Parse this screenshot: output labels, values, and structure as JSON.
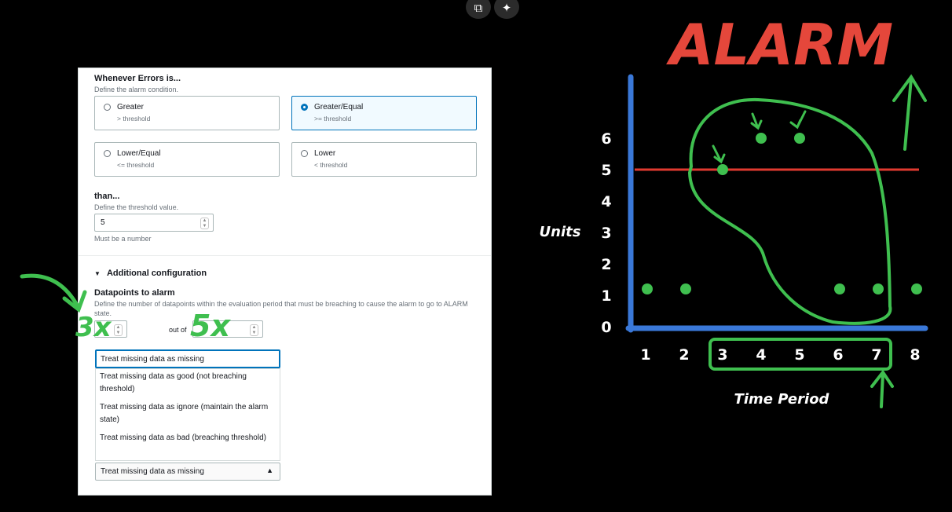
{
  "overlay": {
    "copy_icon": "⧉",
    "sparkle_icon": "✦"
  },
  "form": {
    "condition_label": "Whenever Errors is...",
    "condition_desc": "Define the alarm condition.",
    "options": [
      {
        "title": "Greater",
        "sub": "> threshold",
        "selected": false
      },
      {
        "title": "Greater/Equal",
        "sub": ">= threshold",
        "selected": true
      },
      {
        "title": "Lower/Equal",
        "sub": "<= threshold",
        "selected": false
      },
      {
        "title": "Lower",
        "sub": "< threshold",
        "selected": false
      }
    ],
    "than_label": "than...",
    "than_desc": "Define the threshold value.",
    "threshold_value": "5",
    "threshold_hint": "Must be a number",
    "additional_label": "Additional configuration",
    "datapoints_label": "Datapoints to alarm",
    "datapoints_desc": "Define the number of datapoints within the evaluation period that must be breaching to cause the alarm to go to ALARM state.",
    "out_of_label": "out of",
    "missing_data": {
      "highlighted": "Treat missing data as missing",
      "options": [
        "Treat missing data as good (not breaching threshold)",
        "Treat missing data as ignore (maintain the alarm state)",
        "Treat missing data as bad (breaching threshold)"
      ],
      "selected": "Treat missing data as missing"
    }
  },
  "annotations": {
    "datapoints_count": "3x",
    "out_of_count": "5x"
  },
  "chart_data": {
    "type": "scatter",
    "title": "ALARM",
    "xlabel": "Time Period",
    "ylabel": "Units",
    "x_ticks": [
      "1",
      "2",
      "3",
      "4",
      "5",
      "6",
      "7",
      "8"
    ],
    "y_ticks": [
      "0",
      "1",
      "2",
      "3",
      "4",
      "5",
      "6"
    ],
    "threshold": 5,
    "points": [
      {
        "x": 1,
        "y": 1
      },
      {
        "x": 2,
        "y": 1
      },
      {
        "x": 3,
        "y": 5
      },
      {
        "x": 4,
        "y": 6
      },
      {
        "x": 5,
        "y": 6
      },
      {
        "x": 6,
        "y": 1
      },
      {
        "x": 7,
        "y": 1
      },
      {
        "x": 8,
        "y": 1
      }
    ],
    "evaluation_window": [
      3,
      7
    ],
    "colors": {
      "axis": "#3a78d8",
      "threshold": "#e03a2f",
      "annotation": "#3fbf4f",
      "title": "#e5473b",
      "points": "#3fbf4f"
    }
  }
}
